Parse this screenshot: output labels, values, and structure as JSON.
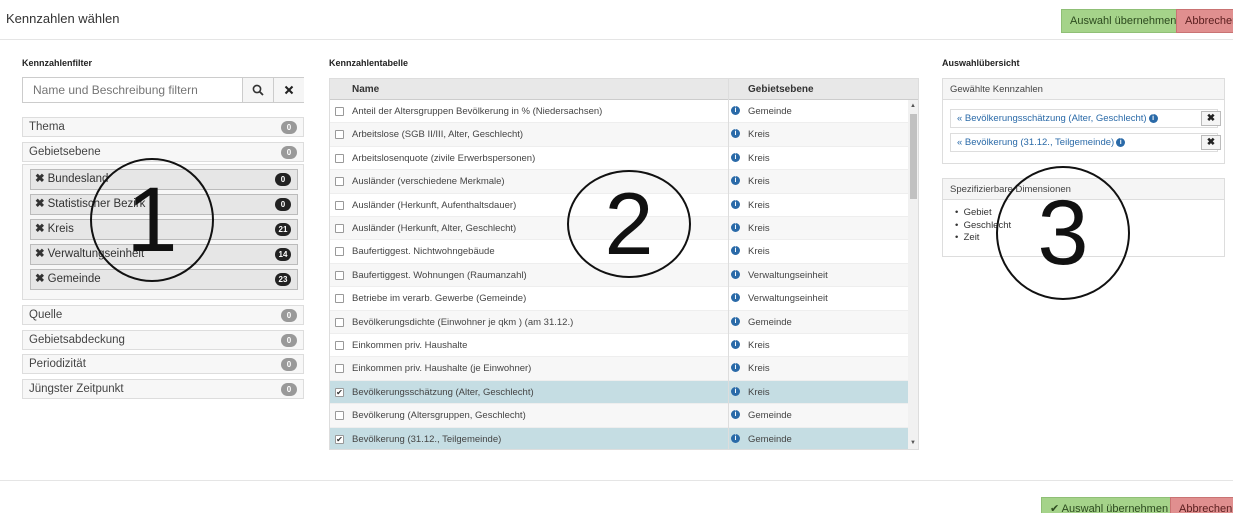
{
  "header": {
    "title": "Kennzahlen wählen",
    "apply_label": "Auswahl übernehmen",
    "cancel_label": "Abbrechen"
  },
  "filter": {
    "section_title": "Kennzahlenfilter",
    "search_placeholder": "Name und Beschreibung filtern",
    "search_icon": "search-icon",
    "clear_icon": "close-icon",
    "facets": [
      {
        "label": "Thema",
        "count": "0"
      },
      {
        "label": "Gebietsebene",
        "count": "0"
      },
      {
        "label": "Quelle",
        "count": "0"
      },
      {
        "label": "Gebietsabdeckung",
        "count": "0"
      },
      {
        "label": "Periodizität",
        "count": "0"
      },
      {
        "label": "Jüngster Zeitpunkt",
        "count": "0"
      }
    ],
    "gebietsebene_items": [
      {
        "label": "Bundesland",
        "count": "0"
      },
      {
        "label": "Statistischer Bezirk",
        "count": "0"
      },
      {
        "label": "Kreis",
        "count": "21"
      },
      {
        "label": "Verwaltungseinheit",
        "count": "14"
      },
      {
        "label": "Gemeinde",
        "count": "23"
      }
    ]
  },
  "table": {
    "section_title": "Kennzahlentabelle",
    "col_name": "Name",
    "col_level": "Gebietsebene",
    "rows": [
      {
        "name": "Anteil der Altersgruppen Bevölkerung in % (Niedersachsen)",
        "level": "Gemeinde",
        "checked": false
      },
      {
        "name": "Arbeitslose (SGB II/III, Alter, Geschlecht)",
        "level": "Kreis",
        "checked": false
      },
      {
        "name": "Arbeitslosenquote (zivile Erwerbspersonen)",
        "level": "Kreis",
        "checked": false
      },
      {
        "name": "Ausländer (verschiedene Merkmale)",
        "level": "Kreis",
        "checked": false
      },
      {
        "name": "Ausländer (Herkunft, Aufenthaltsdauer)",
        "level": "Kreis",
        "checked": false
      },
      {
        "name": "Ausländer (Herkunft, Alter, Geschlecht)",
        "level": "Kreis",
        "checked": false
      },
      {
        "name": "Baufertiggest. Nichtwohngebäude",
        "level": "Kreis",
        "checked": false
      },
      {
        "name": "Baufertiggest. Wohnungen (Raumanzahl)",
        "level": "Verwaltungseinheit",
        "checked": false
      },
      {
        "name": "Betriebe im verarb. Gewerbe (Gemeinde)",
        "level": "Verwaltungseinheit",
        "checked": false
      },
      {
        "name": "Bevölkerungsdichte (Einwohner je qkm ) (am 31.12.)",
        "level": "Gemeinde",
        "checked": false
      },
      {
        "name": "Einkommen priv. Haushalte",
        "level": "Kreis",
        "checked": false
      },
      {
        "name": "Einkommen priv. Haushalte (je Einwohner)",
        "level": "Kreis",
        "checked": false
      },
      {
        "name": "Bevölkerungsschätzung (Alter, Geschlecht)",
        "level": "Kreis",
        "checked": true
      },
      {
        "name": "Bevölkerung (Altersgruppen, Geschlecht)",
        "level": "Gemeinde",
        "checked": false
      },
      {
        "name": "Bevölkerung (31.12., Teilgemeinde)",
        "level": "Gemeinde",
        "checked": true
      }
    ]
  },
  "overview": {
    "section_title": "Auswahlübersicht",
    "selected_title": "Gewählte Kennzahlen",
    "selected": [
      "« Bevölkerungsschätzung (Alter, Geschlecht)",
      "« Bevölkerung (31.12., Teilgemeinde)"
    ],
    "dims_title": "Spezifizierbare Dimensionen",
    "dims": [
      "Gebiet",
      "Geschlecht",
      "Zeit"
    ]
  },
  "footer": {
    "apply_label": "✔ Auswahl übernehmen",
    "cancel_label": "Abbrechen"
  },
  "annotations": [
    "1",
    "2",
    "3"
  ]
}
